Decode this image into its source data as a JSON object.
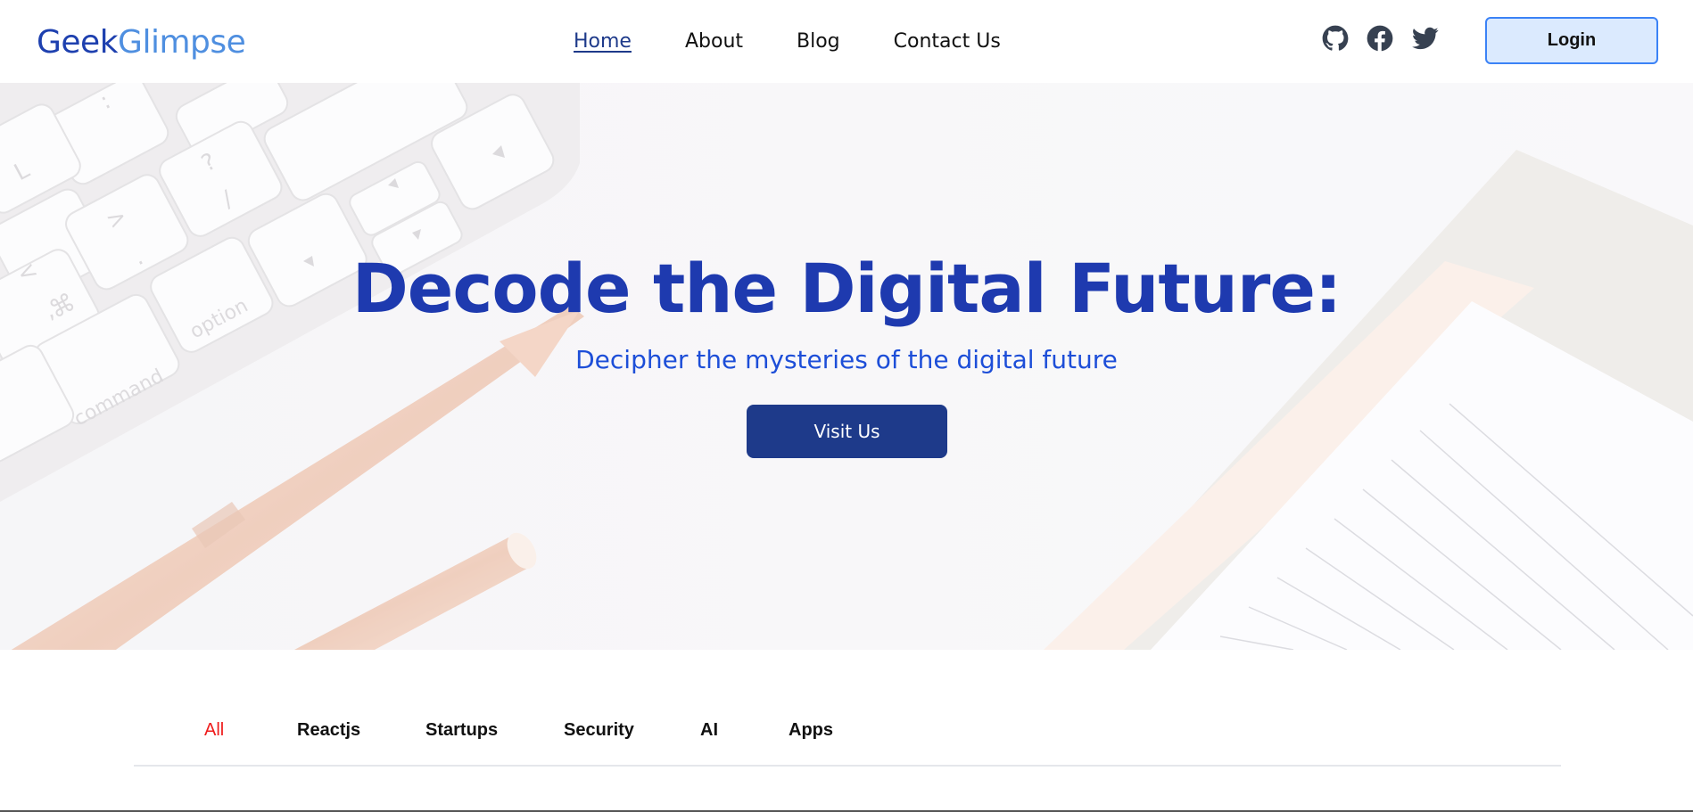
{
  "logo": {
    "part1": "Geek",
    "part2": "Glimpse"
  },
  "nav": {
    "items": [
      {
        "label": "Home",
        "active": true
      },
      {
        "label": "About",
        "active": false
      },
      {
        "label": "Blog",
        "active": false
      },
      {
        "label": "Contact Us",
        "active": false
      }
    ]
  },
  "socials": [
    "github-icon",
    "facebook-icon",
    "twitter-icon"
  ],
  "login_label": "Login",
  "hero": {
    "title": "Decode the Digital Future:",
    "subtitle": "Decipher the mysteries of the digital future",
    "cta_label": "Visit Us"
  },
  "tabs": [
    {
      "label": "All",
      "active": true
    },
    {
      "label": "Reactjs",
      "active": false
    },
    {
      "label": "Startups",
      "active": false
    },
    {
      "label": "Security",
      "active": false
    },
    {
      "label": "AI",
      "active": false
    },
    {
      "label": "Apps",
      "active": false
    }
  ],
  "colors": {
    "brand_dark": "#1e40af",
    "brand_light": "#4f8fe0",
    "cta": "#1e3a8a",
    "active_tab": "#ef1c1c",
    "login_bg": "#dbeafe"
  },
  "hero_image_keys": {
    "keys_row1": [
      "",
      ":",
      ""
    ],
    "keys_row2": [
      "L",
      "?",
      "/"
    ],
    "keys_row3": [
      ">",
      "."
    ],
    "keys_row4": [
      "<",
      ","
    ],
    "option_key": "option",
    "command_key": "command",
    "command_symbol": "⌘"
  }
}
